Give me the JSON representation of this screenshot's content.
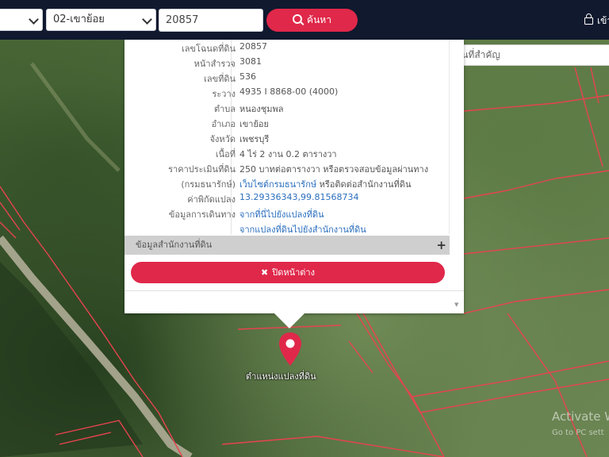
{
  "toolbar": {
    "province_select": "",
    "district_select": "02-เขาย้อย",
    "parcel_input": "20857",
    "search_label": "ค้นหา",
    "login_label": "เข้า"
  },
  "place_search": {
    "placeholder": "ค้นหาสถานที่สำคัญ"
  },
  "popup": {
    "fields": [
      {
        "label": "เลขโฉนดที่ดิน",
        "value": "20857"
      },
      {
        "label": "หน้าสำรวจ",
        "value": "3081"
      },
      {
        "label": "เลขที่ดิน",
        "value": "536"
      },
      {
        "label": "ระวาง",
        "value": "4935 I 8868-00 (4000)"
      },
      {
        "label": "ตำบล",
        "value": "หนองชุมพล"
      },
      {
        "label": "อำเภอ",
        "value": "เขาย้อย"
      },
      {
        "label": "จังหวัด",
        "value": "เพชรบุรี"
      },
      {
        "label": "เนื้อที่",
        "value": "4 ไร่ 2 งาน 0.2 ตารางวา"
      },
      {
        "label": "ราคาประเมินที่ดิน",
        "value": "250 บาทต่อตารางวา หรือตรวจสอบข้อมูลผ่านทาง"
      },
      {
        "label": "(กรมธนารักษ์)",
        "value_link": "เว็บไซต์กรมธนารักษ์",
        "value_rest": " หรือติดต่อสำนักงานที่ดิน"
      },
      {
        "label": "ค่าพิกัดแปลง",
        "value": "13.29336343,99.81568734"
      },
      {
        "label": "ข้อมูลการเดินทาง",
        "value": "จากที่นี่ไปยังแปลงที่ดิน"
      },
      {
        "label": "",
        "value": "จากแปลงที่ดินไปยังสำนักงานที่ดิน"
      }
    ],
    "office_section": "ข้อมูลสำนักงานที่ดิน",
    "office_expand": "+",
    "close_label": "ปิดหน้าต่าง"
  },
  "marker": {
    "label": "ตำแหน่งแปลงที่ดิน"
  },
  "watermark": {
    "line1": "Activate W",
    "line2": "Go to PC sett"
  },
  "colors": {
    "accent": "#e0284a",
    "topbar": "#10192e",
    "link": "#2a6ebd",
    "parcel_line": "#e8434f"
  }
}
